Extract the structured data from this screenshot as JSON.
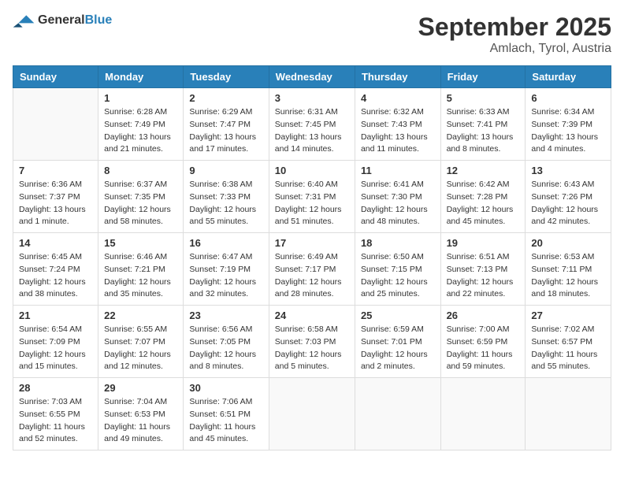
{
  "header": {
    "logo_general": "General",
    "logo_blue": "Blue",
    "month": "September 2025",
    "location": "Amlach, Tyrol, Austria"
  },
  "weekdays": [
    "Sunday",
    "Monday",
    "Tuesday",
    "Wednesday",
    "Thursday",
    "Friday",
    "Saturday"
  ],
  "weeks": [
    [
      {
        "day": "",
        "sunrise": "",
        "sunset": "",
        "daylight": ""
      },
      {
        "day": "1",
        "sunrise": "Sunrise: 6:28 AM",
        "sunset": "Sunset: 7:49 PM",
        "daylight": "Daylight: 13 hours and 21 minutes."
      },
      {
        "day": "2",
        "sunrise": "Sunrise: 6:29 AM",
        "sunset": "Sunset: 7:47 PM",
        "daylight": "Daylight: 13 hours and 17 minutes."
      },
      {
        "day": "3",
        "sunrise": "Sunrise: 6:31 AM",
        "sunset": "Sunset: 7:45 PM",
        "daylight": "Daylight: 13 hours and 14 minutes."
      },
      {
        "day": "4",
        "sunrise": "Sunrise: 6:32 AM",
        "sunset": "Sunset: 7:43 PM",
        "daylight": "Daylight: 13 hours and 11 minutes."
      },
      {
        "day": "5",
        "sunrise": "Sunrise: 6:33 AM",
        "sunset": "Sunset: 7:41 PM",
        "daylight": "Daylight: 13 hours and 8 minutes."
      },
      {
        "day": "6",
        "sunrise": "Sunrise: 6:34 AM",
        "sunset": "Sunset: 7:39 PM",
        "daylight": "Daylight: 13 hours and 4 minutes."
      }
    ],
    [
      {
        "day": "7",
        "sunrise": "Sunrise: 6:36 AM",
        "sunset": "Sunset: 7:37 PM",
        "daylight": "Daylight: 13 hours and 1 minute."
      },
      {
        "day": "8",
        "sunrise": "Sunrise: 6:37 AM",
        "sunset": "Sunset: 7:35 PM",
        "daylight": "Daylight: 12 hours and 58 minutes."
      },
      {
        "day": "9",
        "sunrise": "Sunrise: 6:38 AM",
        "sunset": "Sunset: 7:33 PM",
        "daylight": "Daylight: 12 hours and 55 minutes."
      },
      {
        "day": "10",
        "sunrise": "Sunrise: 6:40 AM",
        "sunset": "Sunset: 7:31 PM",
        "daylight": "Daylight: 12 hours and 51 minutes."
      },
      {
        "day": "11",
        "sunrise": "Sunrise: 6:41 AM",
        "sunset": "Sunset: 7:30 PM",
        "daylight": "Daylight: 12 hours and 48 minutes."
      },
      {
        "day": "12",
        "sunrise": "Sunrise: 6:42 AM",
        "sunset": "Sunset: 7:28 PM",
        "daylight": "Daylight: 12 hours and 45 minutes."
      },
      {
        "day": "13",
        "sunrise": "Sunrise: 6:43 AM",
        "sunset": "Sunset: 7:26 PM",
        "daylight": "Daylight: 12 hours and 42 minutes."
      }
    ],
    [
      {
        "day": "14",
        "sunrise": "Sunrise: 6:45 AM",
        "sunset": "Sunset: 7:24 PM",
        "daylight": "Daylight: 12 hours and 38 minutes."
      },
      {
        "day": "15",
        "sunrise": "Sunrise: 6:46 AM",
        "sunset": "Sunset: 7:21 PM",
        "daylight": "Daylight: 12 hours and 35 minutes."
      },
      {
        "day": "16",
        "sunrise": "Sunrise: 6:47 AM",
        "sunset": "Sunset: 7:19 PM",
        "daylight": "Daylight: 12 hours and 32 minutes."
      },
      {
        "day": "17",
        "sunrise": "Sunrise: 6:49 AM",
        "sunset": "Sunset: 7:17 PM",
        "daylight": "Daylight: 12 hours and 28 minutes."
      },
      {
        "day": "18",
        "sunrise": "Sunrise: 6:50 AM",
        "sunset": "Sunset: 7:15 PM",
        "daylight": "Daylight: 12 hours and 25 minutes."
      },
      {
        "day": "19",
        "sunrise": "Sunrise: 6:51 AM",
        "sunset": "Sunset: 7:13 PM",
        "daylight": "Daylight: 12 hours and 22 minutes."
      },
      {
        "day": "20",
        "sunrise": "Sunrise: 6:53 AM",
        "sunset": "Sunset: 7:11 PM",
        "daylight": "Daylight: 12 hours and 18 minutes."
      }
    ],
    [
      {
        "day": "21",
        "sunrise": "Sunrise: 6:54 AM",
        "sunset": "Sunset: 7:09 PM",
        "daylight": "Daylight: 12 hours and 15 minutes."
      },
      {
        "day": "22",
        "sunrise": "Sunrise: 6:55 AM",
        "sunset": "Sunset: 7:07 PM",
        "daylight": "Daylight: 12 hours and 12 minutes."
      },
      {
        "day": "23",
        "sunrise": "Sunrise: 6:56 AM",
        "sunset": "Sunset: 7:05 PM",
        "daylight": "Daylight: 12 hours and 8 minutes."
      },
      {
        "day": "24",
        "sunrise": "Sunrise: 6:58 AM",
        "sunset": "Sunset: 7:03 PM",
        "daylight": "Daylight: 12 hours and 5 minutes."
      },
      {
        "day": "25",
        "sunrise": "Sunrise: 6:59 AM",
        "sunset": "Sunset: 7:01 PM",
        "daylight": "Daylight: 12 hours and 2 minutes."
      },
      {
        "day": "26",
        "sunrise": "Sunrise: 7:00 AM",
        "sunset": "Sunset: 6:59 PM",
        "daylight": "Daylight: 11 hours and 59 minutes."
      },
      {
        "day": "27",
        "sunrise": "Sunrise: 7:02 AM",
        "sunset": "Sunset: 6:57 PM",
        "daylight": "Daylight: 11 hours and 55 minutes."
      }
    ],
    [
      {
        "day": "28",
        "sunrise": "Sunrise: 7:03 AM",
        "sunset": "Sunset: 6:55 PM",
        "daylight": "Daylight: 11 hours and 52 minutes."
      },
      {
        "day": "29",
        "sunrise": "Sunrise: 7:04 AM",
        "sunset": "Sunset: 6:53 PM",
        "daylight": "Daylight: 11 hours and 49 minutes."
      },
      {
        "day": "30",
        "sunrise": "Sunrise: 7:06 AM",
        "sunset": "Sunset: 6:51 PM",
        "daylight": "Daylight: 11 hours and 45 minutes."
      },
      {
        "day": "",
        "sunrise": "",
        "sunset": "",
        "daylight": ""
      },
      {
        "day": "",
        "sunrise": "",
        "sunset": "",
        "daylight": ""
      },
      {
        "day": "",
        "sunrise": "",
        "sunset": "",
        "daylight": ""
      },
      {
        "day": "",
        "sunrise": "",
        "sunset": "",
        "daylight": ""
      }
    ]
  ]
}
